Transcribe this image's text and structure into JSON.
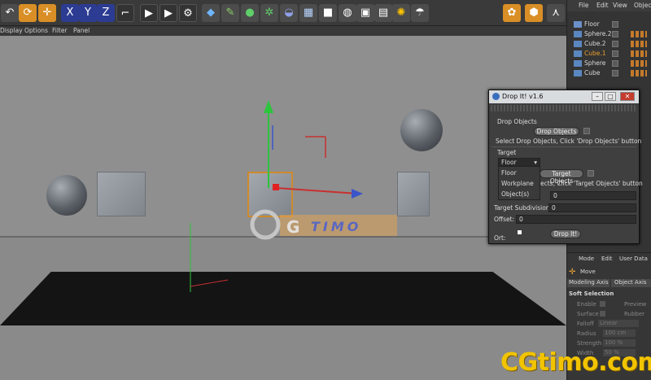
{
  "toolbar": {
    "buttons": [
      "undo-icon",
      "redo-icon",
      "move-icon",
      "x-axis",
      "y-axis",
      "z-axis",
      "coord-icon",
      "render-view-icon",
      "render-icon",
      "render-settings-icon",
      "cube-icon",
      "pen-icon",
      "subdivide-icon",
      "array-icon",
      "deform-icon",
      "floor-icon",
      "camera-icon",
      "light-icon",
      "tag-icon",
      "material-icon",
      "sun-icon",
      "umbrella-icon"
    ],
    "axis_labels": [
      "X",
      "Y",
      "Z"
    ]
  },
  "viewport_menu": [
    "Display",
    "Options",
    "Filter",
    "Panel"
  ],
  "object_manager": {
    "menu": [
      "File",
      "Edit",
      "View",
      "Objec"
    ],
    "objects": [
      {
        "name": "Floor",
        "color": "#d8d8d8"
      },
      {
        "name": "Sphere.2",
        "color": "#d8d8d8"
      },
      {
        "name": "Cube.2",
        "color": "#d8d8d8"
      },
      {
        "name": "Cube.1",
        "color": "#e8a030"
      },
      {
        "name": "Sphere",
        "color": "#d8d8d8"
      },
      {
        "name": "Cube",
        "color": "#d8d8d8"
      }
    ]
  },
  "attributes": {
    "menu": [
      "Mode",
      "Edit",
      "User Data"
    ],
    "move_label": "Move",
    "tabs": [
      "Modeling Axis",
      "Object Axis"
    ],
    "section": "Soft Selection",
    "rows": [
      {
        "label": "Enable",
        "right": "Preview"
      },
      {
        "label": "Surface",
        "right": "Rubber"
      },
      {
        "label": "Falloff",
        "value": "Linear"
      },
      {
        "label": "Radius",
        "value": "100 cm"
      },
      {
        "label": "Strength",
        "value": "100 %"
      },
      {
        "label": "Width",
        "value": "50 %"
      }
    ]
  },
  "dialog": {
    "title": "Drop It! v1.6",
    "drop_objects_heading": "Drop Objects",
    "drop_objects_button": "Drop Objects",
    "drop_objects_hint": "Select Drop Objects, Click 'Drop Objects' button",
    "target_heading": "Target",
    "target_selected": "Floor",
    "target_options": [
      "Floor",
      "Workplane",
      "Object(s)"
    ],
    "target_objects_button": "Target Objects",
    "target_hint_partial": "ects, Click 'Target Objects' button",
    "target_field_value": "0",
    "target_subdivision_label": "Target Subdivision:",
    "target_subdivision_value": "0",
    "offset_label": "Offset:",
    "offset_value": "0",
    "ort_label": "Ort:",
    "drop_button": "Drop It!"
  },
  "watermark": {
    "logo": "CG TIMO",
    "text": "CGtimo.com"
  }
}
